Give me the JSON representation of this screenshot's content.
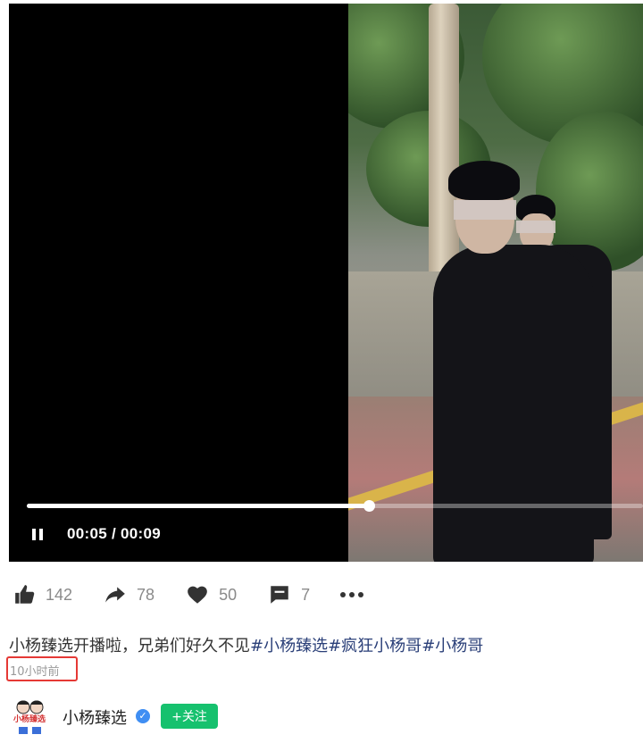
{
  "player": {
    "time_display": "00:05 / 00:09",
    "progress": 0.5556
  },
  "actions": {
    "like_count": "142",
    "share_count": "78",
    "favorite_count": "50",
    "comment_count": "7"
  },
  "post": {
    "caption_text": "小杨臻选开播啦，兄弟们好久不见",
    "hashtags": [
      "#小杨臻选",
      "#疯狂小杨哥",
      "#小杨哥"
    ],
    "timestamp": "10小时前"
  },
  "author": {
    "name": "小杨臻选",
    "avatar_text": "小杨臻选",
    "follow_label": "+关注"
  },
  "colors": {
    "hashtag": "#2a3f78",
    "follow_button": "#16c16e",
    "verified": "#3f8ef3",
    "highlight_box": "#e53935"
  }
}
